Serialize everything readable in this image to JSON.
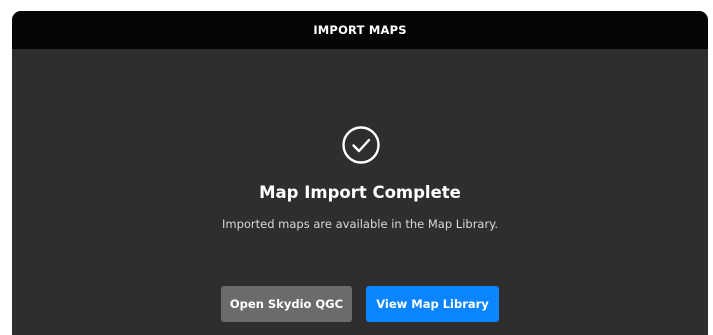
{
  "dialog": {
    "title": "IMPORT MAPS",
    "status_icon": "check-circle-icon",
    "heading": "Map Import Complete",
    "message": "Imported maps are available in the Map Library.",
    "buttons": {
      "secondary_label": "Open Skydio QGC",
      "primary_label": "View Map Library"
    }
  },
  "colors": {
    "header_background": "#050505",
    "dialog_background": "#2e2e2e",
    "secondary_button": "#6b6b6b",
    "primary_button": "#0a84ff"
  }
}
